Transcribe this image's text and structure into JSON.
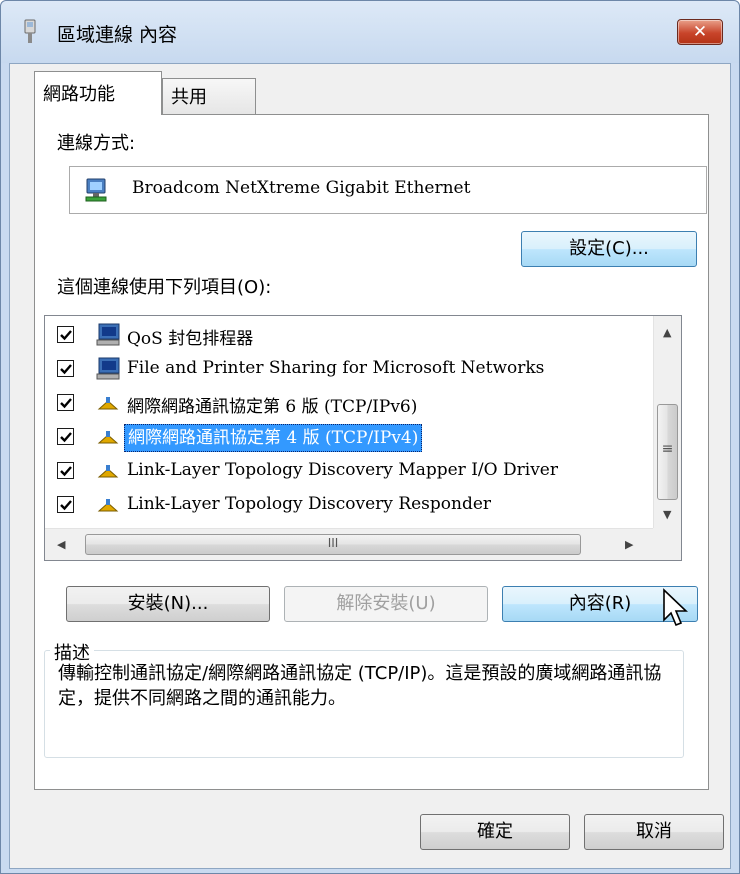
{
  "window": {
    "title": "區域連線 內容",
    "close_glyph": "✕"
  },
  "tabs": [
    {
      "label": "網路功能",
      "active": true
    },
    {
      "label": "共用",
      "active": false
    }
  ],
  "connect_using": {
    "label": "連線方式:",
    "adapter": "Broadcom NetXtreme Gigabit Ethernet",
    "configure_button": "設定(C)..."
  },
  "items_section": {
    "label": "這個連線使用下列項目(O):",
    "items": [
      {
        "label": "QoS 封包排程器",
        "checked": true,
        "icon": "computer-icon",
        "selected": false
      },
      {
        "label": "File and Printer Sharing for Microsoft Networks",
        "checked": true,
        "icon": "computer-icon",
        "selected": false
      },
      {
        "label": "網際網路通訊協定第 6 版 (TCP/IPv6)",
        "checked": true,
        "icon": "protocol-icon",
        "selected": false
      },
      {
        "label": "網際網路通訊協定第 4 版 (TCP/IPv4)",
        "checked": true,
        "icon": "protocol-icon",
        "selected": true
      },
      {
        "label": "Link-Layer Topology Discovery Mapper I/O Driver",
        "checked": true,
        "icon": "protocol-icon",
        "selected": false
      },
      {
        "label": "Link-Layer Topology Discovery Responder",
        "checked": true,
        "icon": "protocol-icon",
        "selected": false
      }
    ],
    "hscroll_grip": "III",
    "vscroll_grip": "≡"
  },
  "actions": {
    "install": "安裝(N)...",
    "uninstall": "解除安裝(U)",
    "properties": "內容(R)"
  },
  "description": {
    "legend": "描述",
    "text": "傳輸控制通訊協定/網際網路通訊協定 (TCP/IP)。這是預設的廣域網路通訊協定，提供不同網路之間的通訊能力。"
  },
  "footer": {
    "ok": "確定",
    "cancel": "取消"
  },
  "colors": {
    "selection": "#3399ff",
    "titlebar": "#c9daf0",
    "close_button": "#c8442a"
  }
}
